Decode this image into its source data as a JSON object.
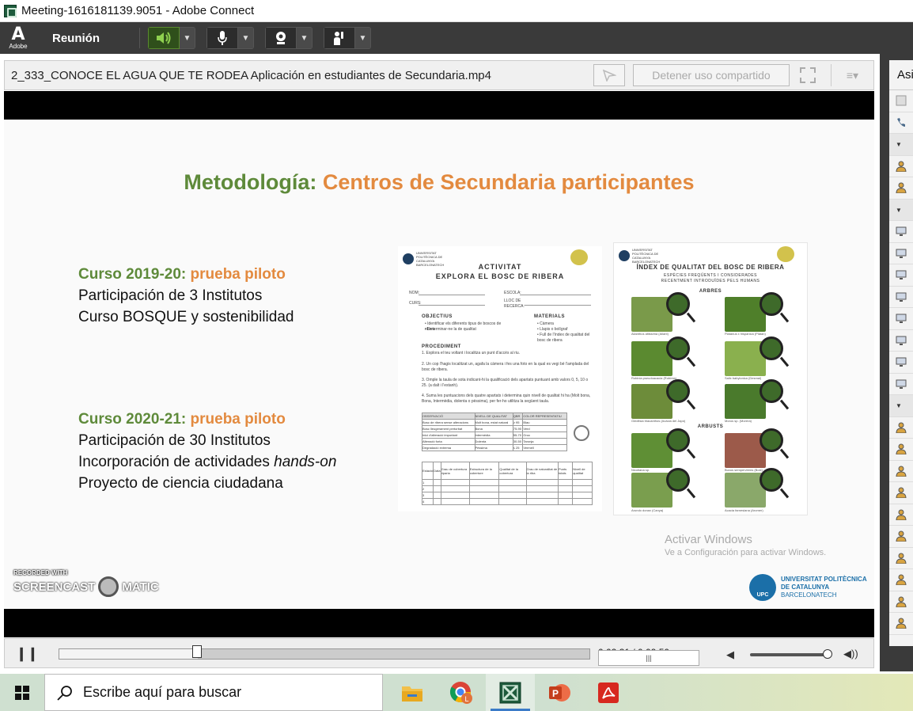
{
  "window": {
    "title": "Meeting-1616181139.9051 - Adobe Connect"
  },
  "menubar": {
    "logo_label": "Adobe",
    "meeting_menu": "Reunión",
    "buttons": [
      {
        "icon": "speaker-icon",
        "active": true
      },
      {
        "icon": "microphone-icon",
        "active": false
      },
      {
        "icon": "webcam-icon",
        "active": false
      },
      {
        "icon": "raise-hand-icon",
        "active": false
      }
    ]
  },
  "share_pod": {
    "title": "2_333_CONOCE EL AGUA QUE TE RODEA Aplicación en estudiantes de Secundaria.mp4",
    "stop_sharing_label": "Detener uso compartido"
  },
  "slide": {
    "title_part1": "Metodología:",
    "title_part2": "Centros de Secundaria participantes",
    "course1": {
      "year": "Curso 2019-20:",
      "tag": "prueba piloto",
      "lines": [
        "Participación de 3 Institutos",
        "Curso BOSQUE y sostenibilidad"
      ]
    },
    "course2": {
      "year": "Curso 2020-21:",
      "tag": "prueba piloto",
      "line1": "Participación de 30 Institutos",
      "line2_prefix": "Incorporación de actividades ",
      "line2_italic": "hands-on",
      "line3": "Proyecto de ciencia ciudadana"
    },
    "doc1": {
      "logo_text": "UNIVERSITAT POLITÈCNICA DE CATALUNYA BARCELONATECH",
      "title_line1": "ACTIVITAT",
      "title_line2": "EXPLORA EL BOSC DE RIBERA",
      "fields": [
        "NOM:",
        "ESCOLA:",
        "CURS:",
        "LLOC DE RECERCA:"
      ],
      "objectius_head": "OBJECTIUS",
      "objectius": [
        "Identificar els diferents tipus de boscos de ribera",
        "Determinar-ne la de qualitat"
      ],
      "materials_head": "MATERIALS",
      "materials": [
        "Càmera",
        "Llapis o bolígraf",
        "Full de l'índex de qualitat del bosc de ribera"
      ],
      "procediment_head": "PROCEDIMENT",
      "steps": [
        "1. Explora el teu voltant i localitza un punt d'accés al riu.",
        "2. Un cop l'hagis localitzat un, agafa la càmera i fes una foto en la qual es vegi bé l'amplada del bosc de ribera.",
        "3. Omple la taula de sota indicant-hi la qualificació dels apartats puntuant amb valors 0, 5, 10 o 25. (a dalt i l'estanh).",
        "4. Suma les puntuacions dels quatre apartats i determina quin nivell de qualitat hi ha (Molt bona, Bona, Intermèdia, dolenta o pèssima), per fer-ho utilitza la següent taula."
      ],
      "table_headers": [
        "OBSERVACIÓ",
        "NIVELL DE QUALITAT",
        "QBR",
        "COLOR REPRESENTATIU"
      ],
      "table_rows": [
        [
          "Bosc de ribera sense alteracions",
          "Molt bona, estat natural",
          "≥ 95",
          "Blau"
        ],
        [
          "Bosc lleugerament pertorbat",
          "Bona",
          "75-90",
          "Verd"
        ],
        [
          "Inici d'alteració important",
          "Intermèdia",
          "55-70",
          "Groc"
        ],
        [
          "Alteració forta",
          "Dolenta",
          "30-50",
          "Taronja"
        ],
        [
          "Degradació extrema",
          "Pèssima",
          "≤ 25",
          "Vermell"
        ]
      ],
      "score_headers": [
        "Estació",
        "Data",
        "Grau de cobertura riparia",
        "Estructura de la coberture",
        "Qualitat de la cobertura",
        "Grau de naturalitat de la riba",
        "Punts totals",
        "Nivell de qualitat"
      ],
      "score_rows": [
        "1",
        "2",
        "3",
        "4"
      ]
    },
    "doc2": {
      "logo_text": "UNIVERSITAT POLITÈCNICA DE CATALUNYA BARCELONATECH",
      "title": "ÍNDEX DE QUALITAT DEL BOSC DE RIBERA",
      "subtitle1": "ESPÈCIES FREQÜENTS I CONSIDERADES",
      "subtitle2": "RECENTMENT INTRODUÏDES PELS HUMANS",
      "section_trees": "ARBRES",
      "section_shrubs": "ARBUSTS",
      "captions": [
        "Ailanthus altissima (Ailant)",
        "Platanus x hispanica (Plàtan)",
        "Robinia pseudoacacia (Robínia)",
        "Salix babylonica (Desmai)",
        "Gleditsia triacanthos (Acàcia del Japó)",
        "Morus sp. (Morera)",
        "Nicotiana sp.",
        "Buxus sempervirens (Boix)",
        "Arundo donax (Canya)",
        "Acacia farnesiana (Aromer)"
      ]
    },
    "activate_windows": "Activar Windows",
    "activate_windows_sub": "Ve a Configuración para activar Windows.",
    "upc_logo_text": "UPC",
    "upc_line1": "UNIVERSITAT POLITÈCNICA",
    "upc_line2": "DE CATALUNYA",
    "upc_line3": "BARCELONATECH",
    "watermark_rec": "RECORDED WITH",
    "watermark_left": "SCREENCAST",
    "watermark_right": "MATIC"
  },
  "player": {
    "time": "0:02:31 / 0:09:50",
    "progress_fraction": 0.26,
    "volume_fraction": 0.98
  },
  "right_panel": {
    "header": "Asi"
  },
  "taskbar": {
    "search_placeholder": "Escribe aquí para buscar",
    "apps": [
      "file-explorer-icon",
      "chrome-icon",
      "adobe-connect-icon",
      "powerpoint-icon",
      "acrobat-icon"
    ]
  },
  "colors": {
    "title_green": "#5e8a3a",
    "title_orange": "#e38a3f",
    "upc_blue": "#1b6fa8",
    "menubar": "#3a3a3a"
  }
}
